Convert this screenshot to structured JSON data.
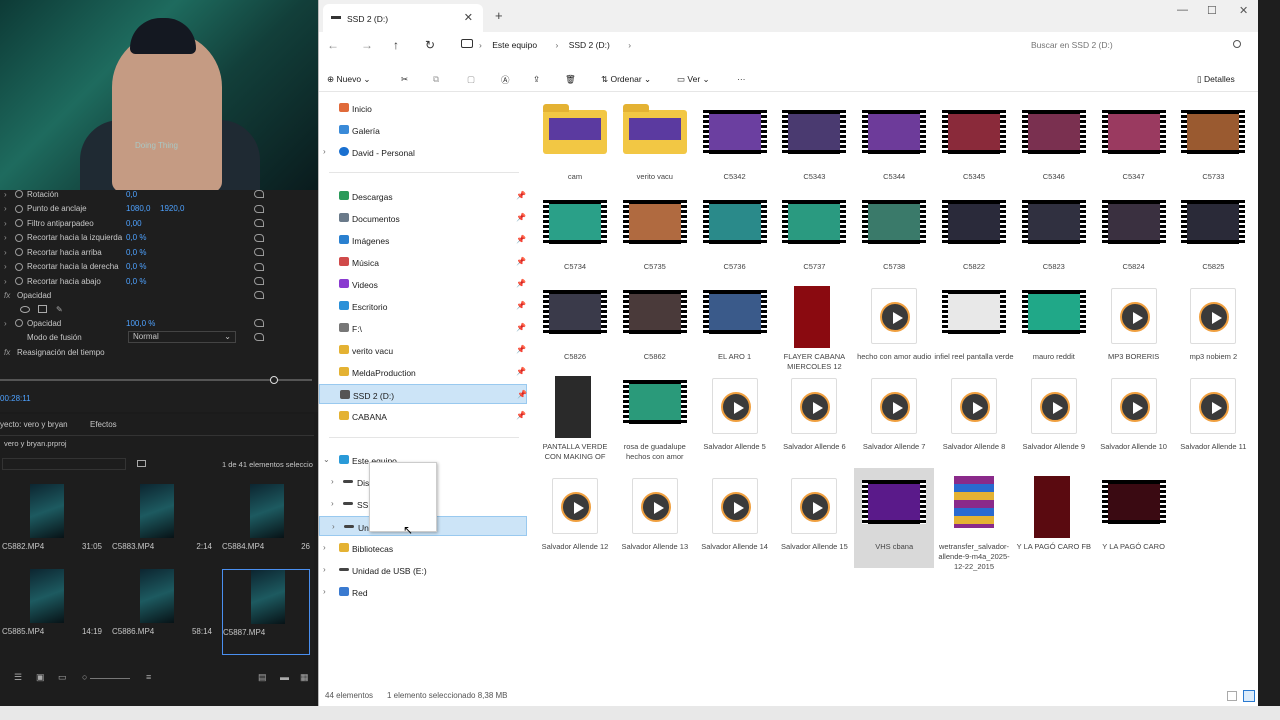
{
  "webcam": {
    "caption": "Doing Thing"
  },
  "premiere": {
    "effect_rows": [
      {
        "label": "Rotación",
        "v1": "0,0",
        "v2": ""
      },
      {
        "label": "Punto de anclaje",
        "v1": "1080,0",
        "v2": "1920,0"
      },
      {
        "label": "Filtro antiparpadeo",
        "v1": "0,00",
        "v2": ""
      },
      {
        "label": "Recortar hacia la izquierda",
        "v1": "0,0 %",
        "v2": ""
      },
      {
        "label": "Recortar hacia arriba",
        "v1": "0,0 %",
        "v2": ""
      },
      {
        "label": "Recortar hacia la derecha",
        "v1": "0,0 %",
        "v2": ""
      },
      {
        "label": "Recortar hacia abajo",
        "v1": "0,0 %",
        "v2": ""
      }
    ],
    "opacity_header": "Opacidad",
    "opacity_label": "Opacidad",
    "opacity_value": "100,0 %",
    "blend_label": "Modo de fusión",
    "blend_value": "Normal",
    "time_remap": "Reasignación del tiempo",
    "timecode": "00:28:11",
    "project_tab": "yecto: vero y bryan",
    "effects_tab": "Efectos",
    "project_file": "vero y bryan.prproj",
    "items_count": "1 de 41 elementos seleccio",
    "clips": [
      {
        "name": "C5882.MP4",
        "dur": "31:05"
      },
      {
        "name": "C5883.MP4",
        "dur": "2:14"
      },
      {
        "name": "C5884.MP4",
        "dur": "26"
      },
      {
        "name": "C5885.MP4",
        "dur": "14:19"
      },
      {
        "name": "C5886.MP4",
        "dur": "58:14"
      },
      {
        "name": "C5887.MP4",
        "dur": ""
      }
    ]
  },
  "explorer": {
    "tab_title": "SSD 2 (D:)",
    "breadcrumb": [
      "Este equipo",
      "SSD 2 (D:)"
    ],
    "search_placeholder": "Buscar en SSD 2 (D:)",
    "commands": {
      "new": "Nuevo",
      "sort": "Ordenar",
      "view": "Ver",
      "more": "···",
      "details": "Detalles"
    },
    "nav": {
      "home": "Inicio",
      "gallery": "Galería",
      "onedrive": "David - Personal",
      "pinned": [
        "Descargas",
        "Documentos",
        "Imágenes",
        "Música",
        "Videos",
        "Escritorio",
        "F:\\",
        "verito vacu",
        "MeldaProduction",
        "SSD 2 (D:)",
        "CABANA"
      ],
      "this_pc": "Este equipo",
      "this_pc_children": [
        "Dis",
        "SSI",
        "Un"
      ],
      "libraries": "Bibliotecas",
      "usb": "Unidad de USB (E:)",
      "network": "Red"
    },
    "items": [
      {
        "name": "cam",
        "kind": "folder"
      },
      {
        "name": "verito vacu",
        "kind": "folder"
      },
      {
        "name": "C5342",
        "kind": "film",
        "color": "#6b3fa0"
      },
      {
        "name": "C5343",
        "kind": "film",
        "color": "#4a3a70"
      },
      {
        "name": "C5344",
        "kind": "film",
        "color": "#6d3b9a"
      },
      {
        "name": "C5345",
        "kind": "film",
        "color": "#8a2a3a"
      },
      {
        "name": "C5346",
        "kind": "film",
        "color": "#7a3050"
      },
      {
        "name": "C5347",
        "kind": "film",
        "color": "#9a3a60"
      },
      {
        "name": "C5733",
        "kind": "film",
        "color": "#9a5a30"
      },
      {
        "name": "C5734",
        "kind": "film",
        "color": "#2aa088"
      },
      {
        "name": "C5735",
        "kind": "film",
        "color": "#b06a40"
      },
      {
        "name": "C5736",
        "kind": "film",
        "color": "#2a8a8a"
      },
      {
        "name": "C5737",
        "kind": "film",
        "color": "#2a9a80"
      },
      {
        "name": "C5738",
        "kind": "film",
        "color": "#3a7a6a"
      },
      {
        "name": "C5822",
        "kind": "film",
        "color": "#2a2a3a"
      },
      {
        "name": "C5823",
        "kind": "film",
        "color": "#303040"
      },
      {
        "name": "C5824",
        "kind": "film",
        "color": "#3a3040"
      },
      {
        "name": "C5825",
        "kind": "film",
        "color": "#2a2a38"
      },
      {
        "name": "C5826",
        "kind": "film",
        "color": "#3a3a4a"
      },
      {
        "name": "C5862",
        "kind": "film",
        "color": "#4a3a3a"
      },
      {
        "name": "EL ARO 1",
        "kind": "film",
        "color": "#3a5a8a"
      },
      {
        "name": "FLAYER CABANA MIERCOLES 12",
        "kind": "tall",
        "color": "#8a0a10"
      },
      {
        "name": "hecho con amor audio",
        "kind": "doc"
      },
      {
        "name": "infiel reel pantalla verde",
        "kind": "film",
        "color": "#e8e8e8"
      },
      {
        "name": "mauro reddit",
        "kind": "film",
        "color": "#20a888"
      },
      {
        "name": "MP3 BORERIS",
        "kind": "doc"
      },
      {
        "name": "mp3 nobiem 2",
        "kind": "doc"
      },
      {
        "name": "PANTALLA VERDE CON MAKING OF",
        "kind": "tall",
        "color": "#2a2a2a"
      },
      {
        "name": "rosa de guadalupe hechos con amor",
        "kind": "film",
        "color": "#2a9a7a"
      },
      {
        "name": "Salvador Allende 5",
        "kind": "doc"
      },
      {
        "name": "Salvador Allende 6",
        "kind": "doc"
      },
      {
        "name": "Salvador Allende 7",
        "kind": "doc"
      },
      {
        "name": "Salvador Allende 8",
        "kind": "doc"
      },
      {
        "name": "Salvador Allende 9",
        "kind": "doc"
      },
      {
        "name": "Salvador Allende 10",
        "kind": "doc"
      },
      {
        "name": "Salvador Allende 11",
        "kind": "doc"
      },
      {
        "name": "Salvador Allende 12",
        "kind": "doc"
      },
      {
        "name": "Salvador Allende 13",
        "kind": "doc"
      },
      {
        "name": "Salvador Allende 14",
        "kind": "doc"
      },
      {
        "name": "Salvador Allende 15",
        "kind": "doc"
      },
      {
        "name": "VHS cbana",
        "kind": "film",
        "color": "#5a1a8a",
        "selected": true
      },
      {
        "name": "wetransfer_salvador-allende-9-m4a_2025-12-22_2015",
        "kind": "zip"
      },
      {
        "name": "Y LA PAGÓ CARO FB",
        "kind": "tall",
        "color": "#5a0a10"
      },
      {
        "name": "Y LA PAGÓ CARO",
        "kind": "film",
        "color": "#3a0a12"
      }
    ],
    "status": {
      "count": "44 elementos",
      "selection": "1 elemento seleccionado  8,38 MB"
    }
  }
}
